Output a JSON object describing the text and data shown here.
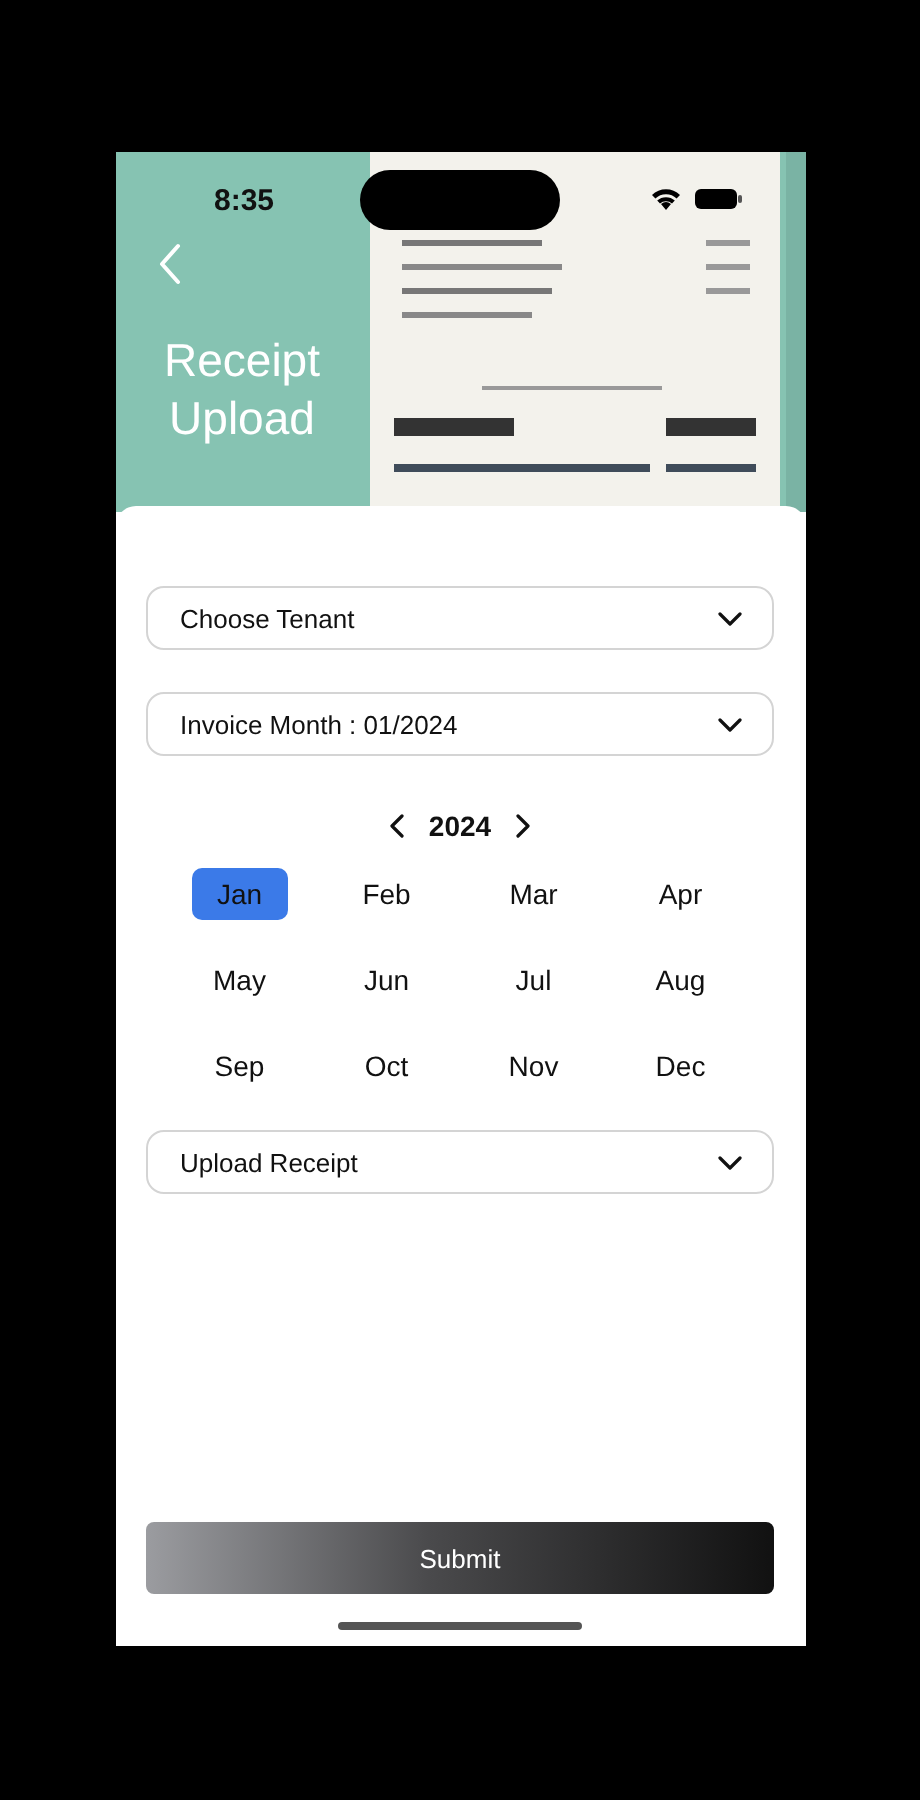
{
  "status_bar": {
    "time": "8:35"
  },
  "header": {
    "title": "Receipt Upload"
  },
  "tenant_select": {
    "label": "Choose Tenant"
  },
  "invoice_month_select": {
    "label": "Invoice Month : 01/2024"
  },
  "month_picker": {
    "year": "2024",
    "months": [
      {
        "label": "Jan",
        "selected": true
      },
      {
        "label": "Feb",
        "selected": false
      },
      {
        "label": "Mar",
        "selected": false
      },
      {
        "label": "Apr",
        "selected": false
      },
      {
        "label": "May",
        "selected": false
      },
      {
        "label": "Jun",
        "selected": false
      },
      {
        "label": "Jul",
        "selected": false
      },
      {
        "label": "Aug",
        "selected": false
      },
      {
        "label": "Sep",
        "selected": false
      },
      {
        "label": "Oct",
        "selected": false
      },
      {
        "label": "Nov",
        "selected": false
      },
      {
        "label": "Dec",
        "selected": false
      }
    ]
  },
  "upload_select": {
    "label": "Upload Receipt"
  },
  "submit_button": {
    "label": "Submit"
  }
}
